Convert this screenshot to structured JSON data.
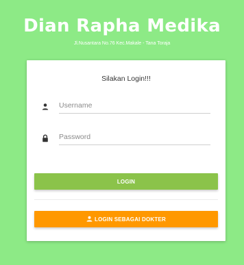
{
  "brand": {
    "title": "Dian Rapha Medika",
    "address": "Jl.Nusantara No.76 Kec.Makale - Tana Toraja"
  },
  "login": {
    "heading": "Silakan Login!!!",
    "username": {
      "placeholder": "Username",
      "value": "",
      "icon": "person-icon"
    },
    "password": {
      "placeholder": "Password",
      "value": "",
      "icon": "lock-icon"
    },
    "login_button_label": "LOGIN",
    "doctor_button_label": "LOGIN SEBAGAI DOKTER",
    "doctor_button_icon": "person-icon"
  },
  "colors": {
    "background": "#8dea86",
    "login_button": "#8bc34a",
    "doctor_button": "#ff9800"
  }
}
